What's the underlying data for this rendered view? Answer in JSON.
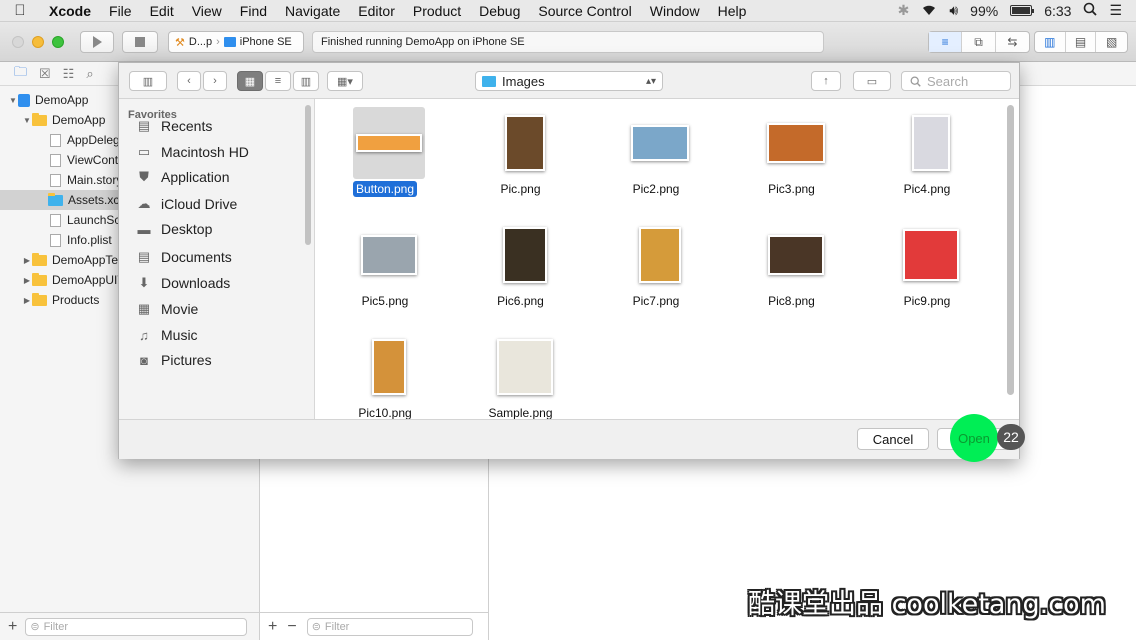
{
  "menubar": {
    "app": "Xcode",
    "items": [
      "File",
      "Edit",
      "View",
      "Find",
      "Navigate",
      "Editor",
      "Product",
      "Debug",
      "Source Control",
      "Window",
      "Help"
    ],
    "battery": "99%",
    "battery_level": 0.99,
    "time": "6:33"
  },
  "toolbar": {
    "scheme_project": "D...p",
    "scheme_device": "iPhone SE",
    "status": "Finished running DemoApp on iPhone SE"
  },
  "navigator": {
    "tree": [
      {
        "label": "DemoApp",
        "kind": "project"
      },
      {
        "label": "DemoApp",
        "kind": "folder"
      },
      {
        "label": "AppDelega",
        "kind": "file"
      },
      {
        "label": "ViewContr",
        "kind": "file"
      },
      {
        "label": "Main.story",
        "kind": "file"
      },
      {
        "label": "Assets.xca",
        "kind": "folder-blue",
        "selected": true
      },
      {
        "label": "LaunchScr",
        "kind": "file"
      },
      {
        "label": "Info.plist",
        "kind": "file"
      },
      {
        "label": "DemoAppTes",
        "kind": "folder"
      },
      {
        "label": "DemoAppUIT",
        "kind": "folder"
      },
      {
        "label": "Products",
        "kind": "folder"
      }
    ],
    "filter_placeholder": "Filter"
  },
  "middle": {
    "filter_placeholder": "Filter",
    "add": "+",
    "remove": "−"
  },
  "dialog": {
    "path": "Images",
    "search_placeholder": "Search",
    "sidebar_title": "Favorites",
    "sidebar_items": [
      "Recents",
      "Macintosh HD",
      "Application",
      "iCloud Drive",
      "Desktop",
      "Documents",
      "Downloads",
      "Movie",
      "Music",
      "Pictures"
    ],
    "files": [
      {
        "name": "Button.png",
        "selected": true,
        "color": "#f0a040"
      },
      {
        "name": "Pic.png",
        "color": "#6b4a2a"
      },
      {
        "name": "Pic2.png",
        "color": "#7ba7c9"
      },
      {
        "name": "Pic3.png",
        "color": "#c46a2a"
      },
      {
        "name": "Pic4.png",
        "color": "#d9d9e0"
      },
      {
        "name": "Pic5.png",
        "color": "#9aa5ae"
      },
      {
        "name": "Pic6.png",
        "color": "#3a3022"
      },
      {
        "name": "Pic7.png",
        "color": "#d59b3a"
      },
      {
        "name": "Pic8.png",
        "color": "#4a3626"
      },
      {
        "name": "Pic9.png",
        "color": "#e23a3a"
      },
      {
        "name": "Pic10.png",
        "color": "#d4923a"
      },
      {
        "name": "Sample.png",
        "color": "#e9e6dc"
      }
    ],
    "cancel": "Cancel",
    "open": "Open"
  },
  "step": "22",
  "watermark": "酷课堂出品 coolketang.com"
}
